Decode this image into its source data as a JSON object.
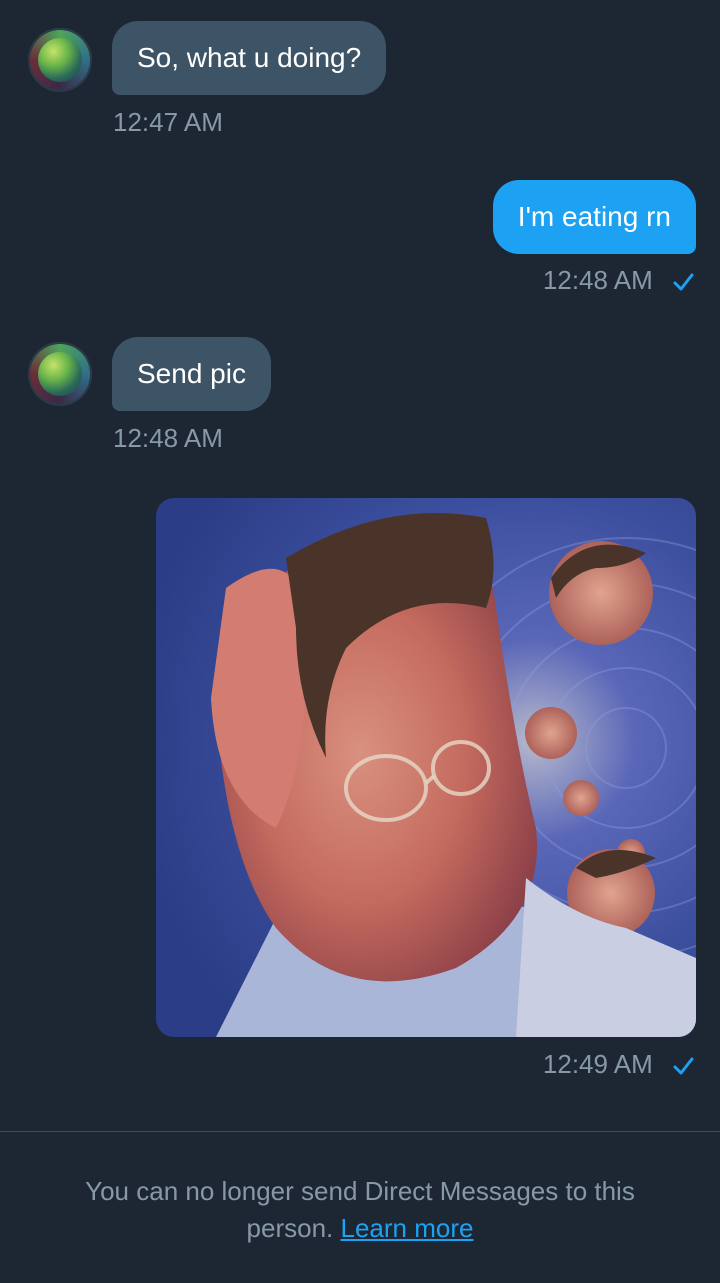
{
  "messages": [
    {
      "direction": "incoming",
      "text": "So, what u doing?",
      "time": "12:47 AM"
    },
    {
      "direction": "outgoing",
      "text": "I'm eating rn",
      "time": "12:48 AM",
      "status": "sent-check-icon"
    },
    {
      "direction": "incoming",
      "text": "Send pic",
      "time": "12:48 AM"
    },
    {
      "direction": "outgoing",
      "type": "image",
      "time": "12:49 AM",
      "status": "sent-check-icon"
    }
  ],
  "footer": {
    "notice_text": "You can no longer send Direct Messages to this person.",
    "learn_more": "Learn more"
  },
  "colors": {
    "background": "#1c2733",
    "incoming_bubble": "#3d5466",
    "outgoing_bubble": "#1da1f2",
    "timestamp": "#8899a6",
    "link": "#1da1f2"
  }
}
